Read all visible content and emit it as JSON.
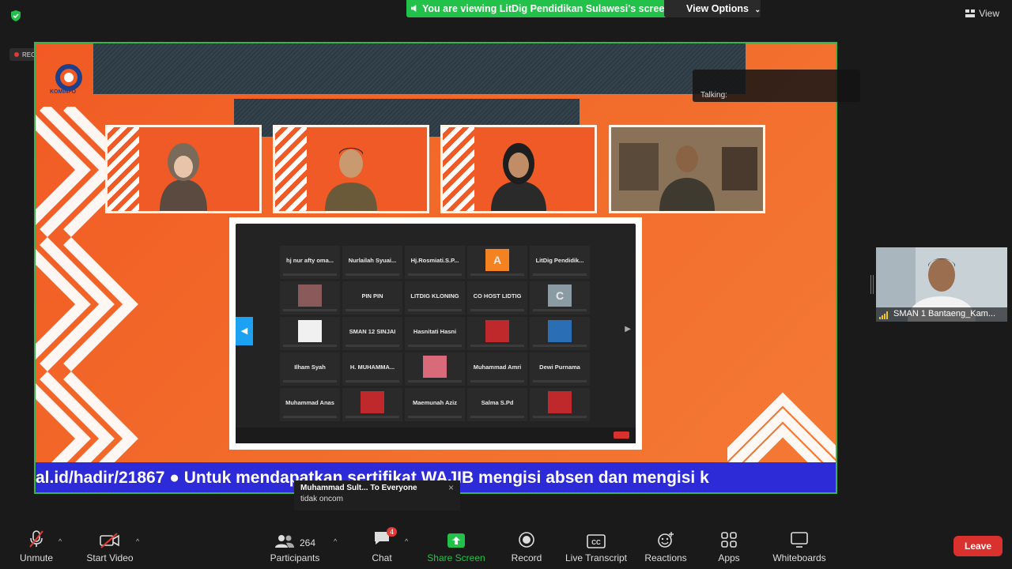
{
  "topbar": {
    "share_banner": "You are viewing LitDig Pendidikan Sulawesi's screen",
    "view_options": "View Options",
    "view": "View"
  },
  "share": {
    "rec_label": "REC",
    "logo_text": "KOMINFO",
    "talking_label": "Talking:",
    "ticker_text": "al.id/hadir/21867  ●  Untuk mendapatkan sertifikat WAJIB mengisi absen dan mengisi k",
    "inner_grid": [
      [
        "hj nur afty oma...",
        "Nurlailah Syuai...",
        "Hj.Rosmiati.S.P...",
        "A",
        "LitDig Pendidik..."
      ],
      [
        "",
        "PIN PIN",
        "LITDIG KLONING",
        "CO HOST LIDTIG",
        "C"
      ],
      [
        "",
        "SMAN 12 SINJAI",
        "Hasnitati Hasni",
        "",
        ""
      ],
      [
        "Ilham Syah",
        "H. MUHAMMA...",
        "",
        "Muhammad Amri",
        "Dewi Purnama"
      ],
      [
        "Muhammad Anas",
        "",
        "Maemunah Aziz",
        "Salma S.Pd",
        ""
      ]
    ]
  },
  "chat_popup": {
    "from": "Muhammad Sult... To Everyone",
    "message": "tidak oncom"
  },
  "side_video": {
    "label": "SMAN 1 Bantaeng_Kam..."
  },
  "toolbar": {
    "unmute": "Unmute",
    "start_video": "Start Video",
    "participants": "Participants",
    "participant_count": "264",
    "chat": "Chat",
    "chat_badge": "4",
    "share_screen": "Share Screen",
    "record": "Record",
    "live_transcript": "Live Transcript",
    "reactions": "Reactions",
    "apps": "Apps",
    "whiteboards": "Whiteboards",
    "leave": "Leave"
  },
  "colors": {
    "accent_green": "#22c24a",
    "leave_red": "#d9322e",
    "share_orange": "#f15a24",
    "ticker_blue": "#2d2ad8"
  }
}
